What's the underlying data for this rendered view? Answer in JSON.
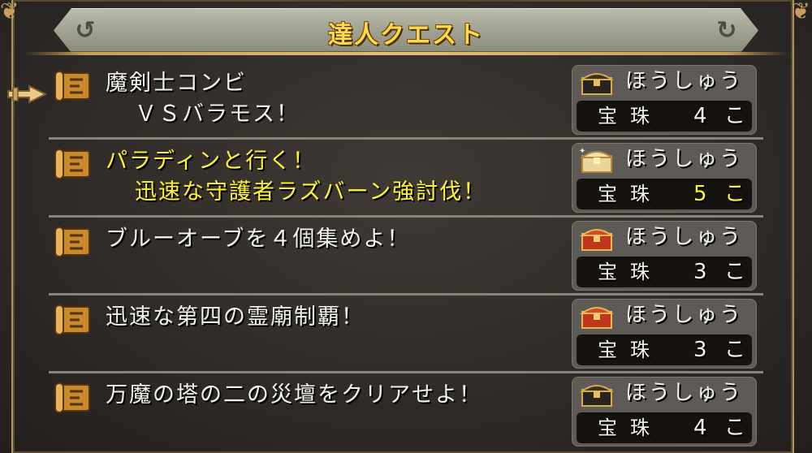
{
  "title": "達人クエスト",
  "colors": {
    "title_text": "#ffd84a",
    "highlight_text": "#fdf23a",
    "normal_text": "#f2f2ec",
    "frame_gold": "#c79e5c"
  },
  "reward_label": "ほうしゅう",
  "quests": [
    {
      "title_line1": "魔剣士コンビ",
      "title_line2": "ＶＳバラモス！",
      "reward_item": "宝珠",
      "reward_count": "4",
      "reward_unit": "こ",
      "chest_icon": "treasure-chest-black-icon",
      "highlighted": false,
      "selected": true
    },
    {
      "title_line1": "パラディンと行く！",
      "title_line2": "迅速な守護者ラズバーン強討伐！",
      "reward_item": "宝珠",
      "reward_count": "5",
      "reward_unit": "こ",
      "chest_icon": "treasure-chest-gold-icon",
      "highlighted": true,
      "selected": false
    },
    {
      "title_line1": "ブルーオーブを４個集めよ！",
      "title_line2": "",
      "reward_item": "宝珠",
      "reward_count": "3",
      "reward_unit": "こ",
      "chest_icon": "treasure-chest-red-icon",
      "highlighted": false,
      "selected": false
    },
    {
      "title_line1": "迅速な第四の霊廟制覇！",
      "title_line2": "",
      "reward_item": "宝珠",
      "reward_count": "3",
      "reward_unit": "こ",
      "chest_icon": "treasure-chest-red-icon",
      "highlighted": false,
      "selected": false
    },
    {
      "title_line1": "万魔の塔の二の災壇をクリアせよ！",
      "title_line2": "",
      "reward_item": "宝珠",
      "reward_count": "4",
      "reward_unit": "こ",
      "chest_icon": "treasure-chest-black-icon",
      "highlighted": false,
      "selected": false
    }
  ]
}
